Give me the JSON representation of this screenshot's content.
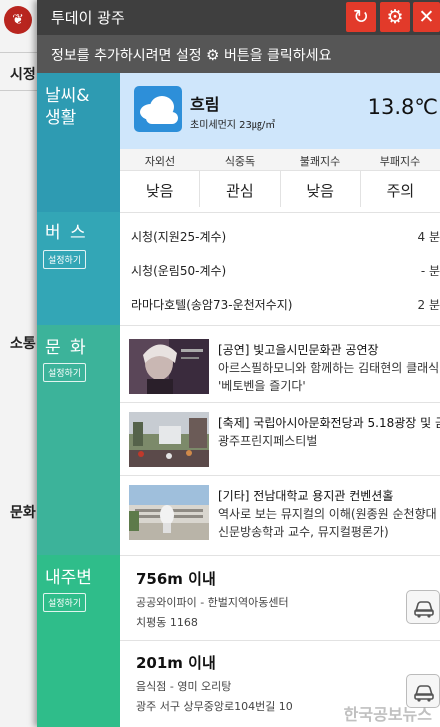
{
  "background": {
    "logo": "❦",
    "labels": [
      "시정",
      "소통",
      "문화"
    ]
  },
  "titlebar": {
    "title": "투데이 광주",
    "refresh_icon": "refresh-icon",
    "settings_icon": "gear-icon",
    "close_icon": "close-icon"
  },
  "notice": {
    "prefix": "정보를 추가하시려면 설정",
    "suffix": "버튼을 클릭하세요"
  },
  "categories": {
    "weather": {
      "title": "날씨&\n생활",
      "color": "#2e9bb2"
    },
    "bus": {
      "title": "버 스",
      "button": "설정하기",
      "color": "#33a6b6"
    },
    "culture": {
      "title": "문 화",
      "button": "설정하기",
      "color": "#3cb39a"
    },
    "nearby": {
      "title": "내주변",
      "button": "설정하기",
      "color": "#2fbd8a"
    }
  },
  "weather": {
    "condition": "흐림",
    "dust": "초미세먼지 23㎍/㎥",
    "temp": "13.8℃",
    "indices": [
      {
        "label": "자외선",
        "value": "낮음"
      },
      {
        "label": "식중독",
        "value": "관심"
      },
      {
        "label": "불쾌지수",
        "value": "낮음"
      },
      {
        "label": "부패지수",
        "value": "주의"
      }
    ]
  },
  "bus": {
    "routes": [
      {
        "name": "시청(지원25-계수)",
        "time": "4 분"
      },
      {
        "name": "시청(운림50-계수)",
        "time": "- 분"
      },
      {
        "name": "라마다호텔(송암73-운천저수지)",
        "time": "2 분"
      }
    ]
  },
  "culture": {
    "items": [
      {
        "tag": "[공연]",
        "title": "빛고을시민문화관 공연장",
        "line2": "아르스필하모니와 함께하는 김태현의 클래식여행",
        "line3": "'베토벤을 즐기다'"
      },
      {
        "tag": "[축제]",
        "title": "국립아시아문화전당과 5.18광장 및 금",
        "line2": "광주프린지페스티벌",
        "line3": ""
      },
      {
        "tag": "[기타]",
        "title": "전남대학교 용지관 컨벤션홀",
        "line2": "역사로 보는 뮤지컬의 이해(원종원 순천향대",
        "line3": "신문방송학과 교수, 뮤지컬평론가)"
      }
    ]
  },
  "nearby": {
    "items": [
      {
        "distance": "756m 이내",
        "place": "공공와이파이 - 한벌지역아동센터",
        "address": "치평동 1168"
      },
      {
        "distance": "201m 이내",
        "place": "음식점 - 영미 오리탕",
        "address": "광주 서구 상무중앙로104번길 10"
      }
    ]
  },
  "watermark": "한국공보뉴스"
}
